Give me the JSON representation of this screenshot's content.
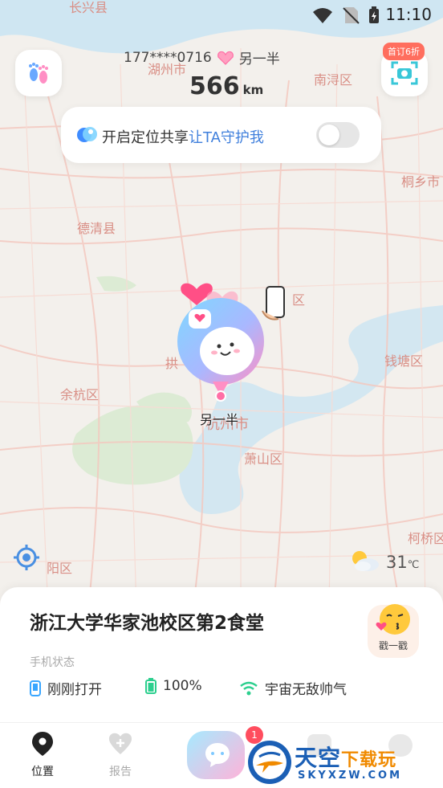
{
  "status_bar": {
    "time": "11:10"
  },
  "header": {
    "partner_phone": "177****0716",
    "partner_name": "另一半",
    "distance_value": "566",
    "distance_unit": "km",
    "promo_badge": "首订6折"
  },
  "share_card": {
    "text": "开启定位共享",
    "link": "让TA守护我",
    "toggle_on": false
  },
  "map": {
    "labels": [
      "长兴县",
      "湖州市",
      "南浔区",
      "桐乡市",
      "德清县",
      "区",
      "拱",
      "钱塘区",
      "余杭区",
      "杭州市",
      "萧山区",
      "柯桥区",
      "阳区"
    ]
  },
  "marker": {
    "name": "另一半"
  },
  "weather": {
    "temperature": "31",
    "unit": "℃",
    "icon": "partly-cloudy-icon"
  },
  "location_card": {
    "place": "浙江大学华家池校区第2食堂",
    "phone_status_label": "手机状态",
    "screen_status": "刚刚打开",
    "battery": "100%",
    "wifi": "宇宙无敌帅气",
    "poke_label": "戳一戳"
  },
  "tabbar": {
    "tabs": [
      {
        "label": "位置",
        "active": true
      },
      {
        "label": "报告",
        "active": false
      }
    ],
    "chat_badge": "1"
  },
  "watermark": {
    "title_blue": "天空",
    "title_orange": "下载玩",
    "domain": "SKYXZW.COM"
  },
  "colors": {
    "accent_blue": "#3f7fdc",
    "pink": "#ff5c8a",
    "badge_red": "#ff4d5e",
    "map_label": "#d98f86"
  }
}
